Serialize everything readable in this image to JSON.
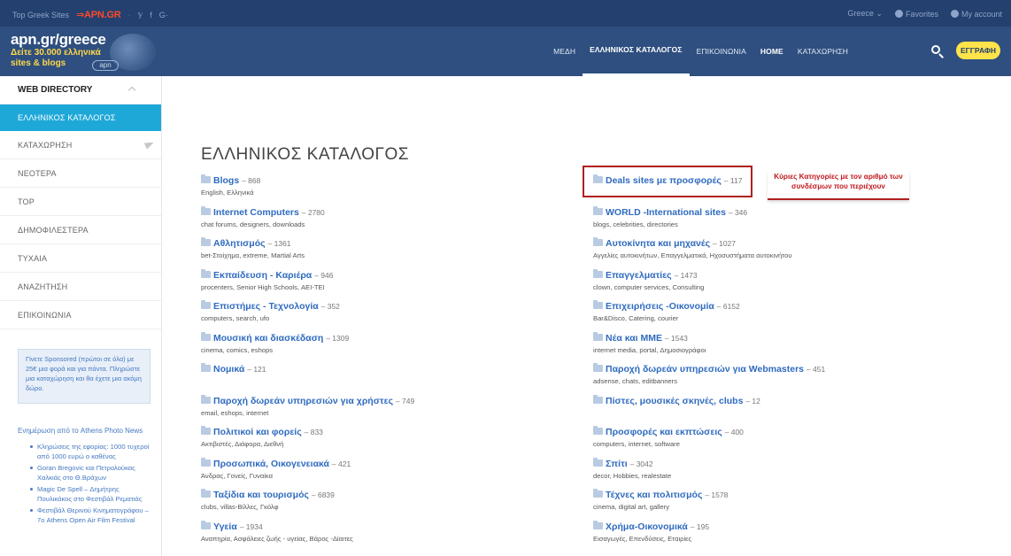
{
  "topbar": {
    "label": "Top Greek Sites",
    "brand": "⇒APN.GR",
    "social": [
      "𝕪",
      "f",
      "G·"
    ],
    "region": "Greece ⌄",
    "favorites": "Favorites",
    "account": "My account"
  },
  "logo": {
    "line1": "apn.gr/greece",
    "line2": "Δείτε 30.000 ελληνικά",
    "line3": "sites & blogs",
    "mark": "apn"
  },
  "nav": {
    "items": [
      "ΜΕΔΗ",
      "ΕΛΛΗΝΙΚΟΣ ΚΑΤΑΛΟΓΟΣ",
      "ΕΠΙΚΟΙΝΩΝΙΑ",
      "HOME",
      "ΚΑΤΑΧΩΡΗΣΗ"
    ],
    "register": "ΕΓΓΡΑΦΗ"
  },
  "sidebar": {
    "heading": "WEB DIRECTORY",
    "items": [
      "ΕΛΛΗΝΙΚΟΣ ΚΑΤΑΛΟΓΟΣ",
      "ΚΑΤΑΧΩΡΗΣΗ",
      "ΝΕΟΤΕΡΑ",
      "TOP",
      "ΔΗΜΟΦΙΛΕΣΤΕΡΑ",
      "ΤΥΧΑΙΑ",
      "ΑΝΑΖΗΤΗΣΗ",
      "ΕΠΙΚΟΙΝΩΝΙΑ"
    ],
    "promo": "Γίνετε Sponsored (πρώτοι σε όλα) με 25€ μια φορά και για πάντα. Πληρώστε μια καταχώρηση και θα έχετε μια ακόμη δώρο.",
    "news_title": "Ενημέρωση από το Athens Photo News",
    "news": [
      "Κληρώσεις της εφορίας: 1000 τυχεροί από 1000 ευρώ ο καθένας",
      "Goran Bregovic και Πετρολούκας Χαλκιάς στο Θ.Βράχων",
      "Magic De Spell – Δημήτρης Πουλικάκος στο Φεστιβάλ Ρεματιάς",
      "Φεστιβάλ Θερινού Κινηματογράφου – 7ο Athens Open Air Film Festival"
    ]
  },
  "main": {
    "title": "ΕΛΛΗΝΙΚΟΣ ΚΑΤΑΛΟΓΟΣ",
    "annotation": "Κύριες Κατηγορίες με τον αριθμό των συνδέσμων που περιέχουν",
    "left": [
      {
        "name": "Blogs",
        "count": "– 868",
        "sub": "English, Ελληνικά"
      },
      {
        "name": "Internet Computers",
        "count": "– 2780",
        "sub": "chat forums, designers, downloads"
      },
      {
        "name": "Αθλητισμός",
        "count": "– 1361",
        "sub": "bet-Στοίχημα, extreme, Martial Arts"
      },
      {
        "name": "Εκπαίδευση - Καριέρα",
        "count": "– 946",
        "sub": "procenters, Senior High Schools, ΑΕΙ-ΤΕΙ"
      },
      {
        "name": "Επιστήμες - Τεχνολογία",
        "count": "– 352",
        "sub": "computers, search, ufo"
      },
      {
        "name": "Μουσική και διασκέδαση",
        "count": "– 1309",
        "sub": "cinema, comics, eshops"
      },
      {
        "name": "Νομικά",
        "count": "– 121",
        "sub": ""
      },
      {
        "name": "Παροχή δωρεάν υπηρεσιών για χρήστες",
        "count": "– 749",
        "sub": "email, eshops, internet"
      },
      {
        "name": "Πολιτικοί και φορείς",
        "count": "– 833",
        "sub": "Ακτιβιστές, Διάφορα, Διεθνή"
      },
      {
        "name": "Προσωπικά, Οικογενειακά",
        "count": "– 421",
        "sub": "Άνδρας, Γονείς, Γυναίκα"
      },
      {
        "name": "Ταξίδια και τουρισμός",
        "count": "– 6839",
        "sub": "clubs, villas-Βίλλες, Γκόλφ"
      },
      {
        "name": "Υγεία",
        "count": "– 1934",
        "sub": "Αναπηρία, Ασφάλειες ζωής - υγείας, Βάρος -Δίαιτες"
      }
    ],
    "right": [
      {
        "name": "Deals sites με προσφορές",
        "count": "– 117",
        "sub": ""
      },
      {
        "name": "WORLD -International sites",
        "count": "– 346",
        "sub": "blogs, celebrities, directories"
      },
      {
        "name": "Αυτοκίνητα και μηχανές",
        "count": "– 1027",
        "sub": "Αγγελίες αυτοκινήτων, Επαγγελματικά, Ηχοσυστήματα αυτοκινήτου"
      },
      {
        "name": "Επαγγελματίες",
        "count": "– 1473",
        "sub": "clown, computer services, Consulting"
      },
      {
        "name": "Επιχειρήσεις -Οικονομία",
        "count": "– 6152",
        "sub": "Bar&Disco, Catering, courier"
      },
      {
        "name": "Νέα και ΜΜΕ",
        "count": "– 1543",
        "sub": "internet media, portal, Δημοσιογράφοι"
      },
      {
        "name": "Παροχή δωρεάν υπηρεσιών για Webmasters",
        "count": "– 451",
        "sub": "adsense, chats, editbanners"
      },
      {
        "name": "Πίστες, μουσικές σκηνές, clubs",
        "count": "– 12",
        "sub": ""
      },
      {
        "name": "Προσφορές και εκπτώσεις",
        "count": "– 400",
        "sub": "computers, internet, software"
      },
      {
        "name": "Σπίτι",
        "count": "– 3042",
        "sub": "decor, Hobbies, realestate"
      },
      {
        "name": "Τέχνες και πολιτισμός",
        "count": "– 1578",
        "sub": "cinema, digital art, gallery"
      },
      {
        "name": "Χρήμα-Οικονομικά",
        "count": "– 195",
        "sub": "Εισαγωγές, Επενδύσεις, Εταιρίες"
      }
    ]
  }
}
